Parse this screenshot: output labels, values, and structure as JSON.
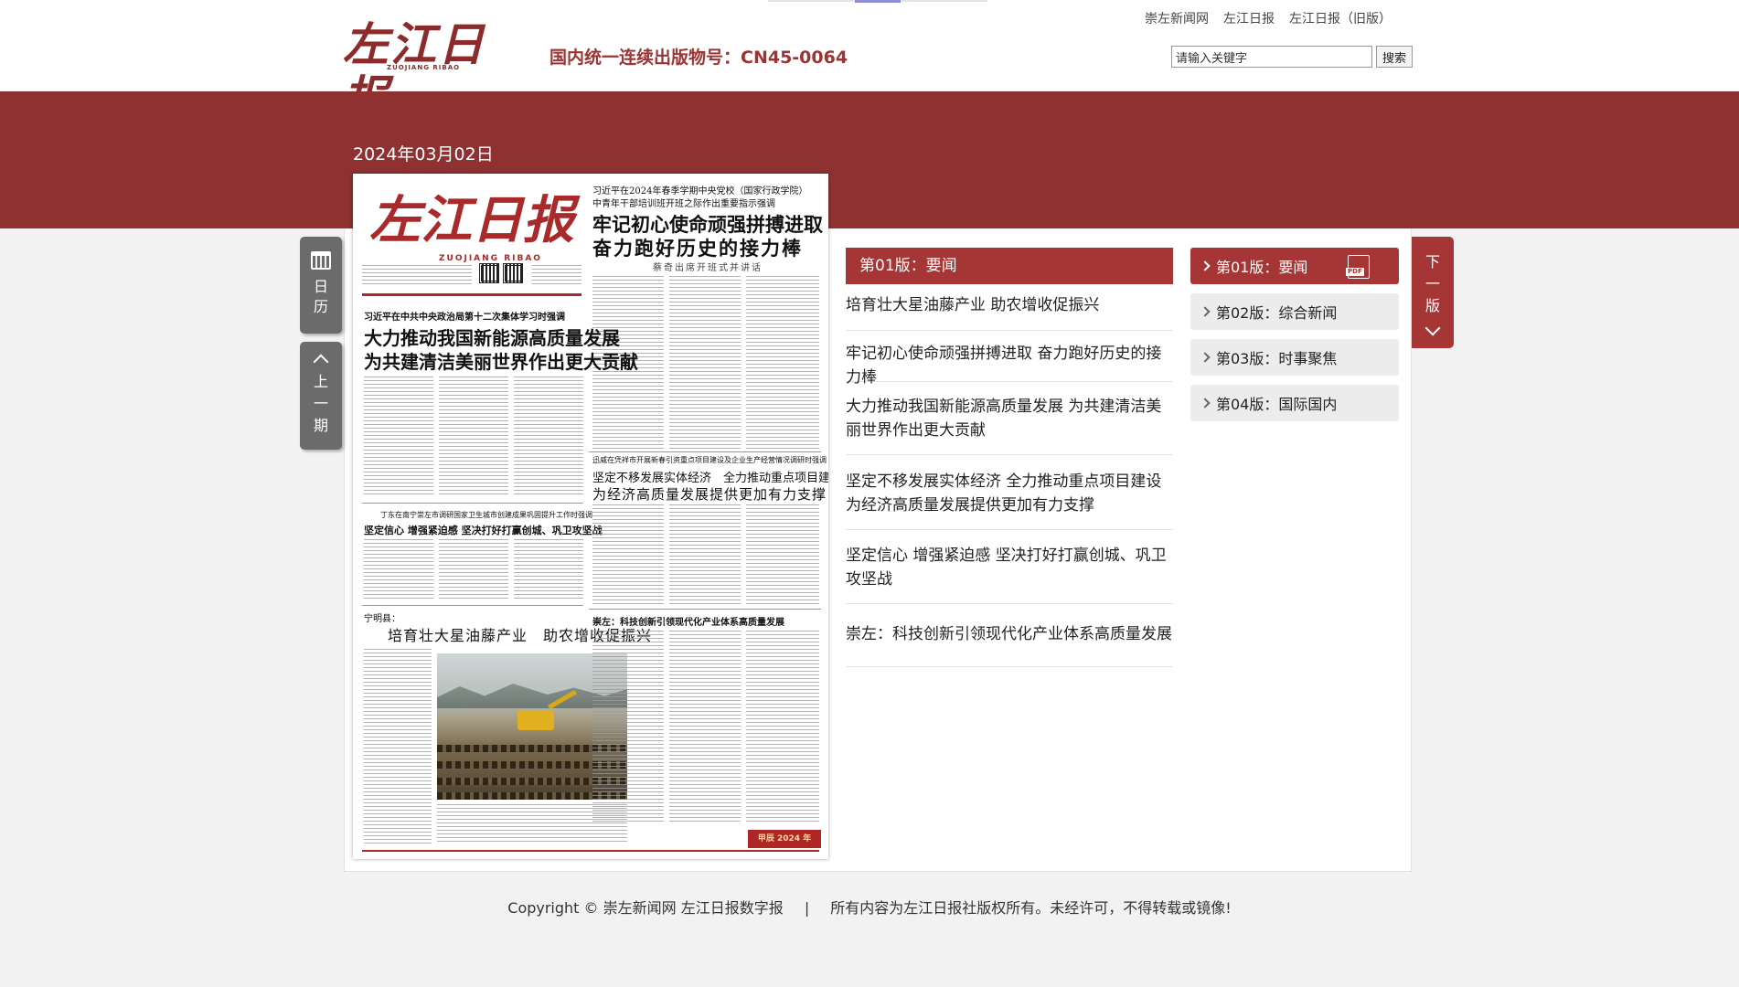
{
  "header": {
    "logo_text": "左江日报",
    "logo_sub": "ZUOJIANG RIBAO",
    "cn_number": "国内统一连续出版物号：CN45-0064",
    "links": [
      "崇左新闻网",
      "左江日报",
      "左江日报（旧版）"
    ],
    "search": {
      "placeholder": "请输入关键字",
      "button_label": "搜索"
    }
  },
  "date": "2024年03月02日",
  "newspaper": {
    "masthead": "左江日报",
    "masthead_sub": "ZUOJIANG RIBAO",
    "top_kicker_1": "习近平在2024年春季学期中央党校（国家行政学院）",
    "top_kicker_2": "中青年干部培训班开班之际作出重要指示强调",
    "top_head_1": "牢记初心使命顽强拼搏进取",
    "top_head_2": "奋力跑好历史的接力棒",
    "top_sub": "蔡奇出席开班式并讲话",
    "left_kicker": "习近平在中共中央政治局第十二次集体学习时强调",
    "left_head_1": "大力推动我国新能源高质量发展",
    "left_head_2": "为共建清洁美丽世界作出更大贡献",
    "mid_kicker": "迅威在凭祥市开展新春引资重点项目建设及企业生产经营情况调研时强调",
    "mid_head_1": "坚定不移发展实体经济　全力推动重点项目建设",
    "mid_head_2": "为经济高质量发展提供更加有力支撑",
    "small_kicker": "丁东在南宁崇左市调研国家卫生城市创建成果巩固提升工作时强调",
    "small_head": "坚定信心 增强紧迫感 坚决打好打赢创城、巩卫攻坚战",
    "bottom_kicker": "宁明县：",
    "bottom_head": "培育壮大星油藤产业　助农增收促振兴",
    "right_head": "崇左：科技创新引领现代化产业体系高质量发展",
    "badge": "甲辰 2024 年"
  },
  "tabs": {
    "calendar_label": "日历",
    "prev_label": "上一期",
    "next_label": "下一版"
  },
  "articles": {
    "heading": "第01版：要闻",
    "items": [
      "培育壮大星油藤产业 助农增收促振兴",
      "牢记初心使命顽强拼搏进取 奋力跑好历史的接力棒",
      "大力推动我国新能源高质量发展 为共建清洁美丽世界作出更大贡献",
      "坚定不移发展实体经济 全力推动重点项目建设 为经济高质量发展提供更加有力支撑",
      "坚定信心 增强紧迫感 坚决打好打赢创城、巩卫攻坚战",
      "崇左：科技创新引领现代化产业体系高质量发展"
    ]
  },
  "pages": {
    "items": [
      {
        "label": "第01版：要闻",
        "active": true
      },
      {
        "label": "第02版：综合新闻",
        "active": false
      },
      {
        "label": "第03版：时事聚焦",
        "active": false
      },
      {
        "label": "第04版：国际国内",
        "active": false
      }
    ],
    "pdf_label": "PDF"
  },
  "footer": {
    "copyright": "Copyright © 崇左新闻网 左江日报数字报",
    "separator": "|",
    "notice": "所有内容为左江日报社版权所有。未经许可，不得转载或镜像!"
  },
  "colors": {
    "brand_red": "#8f3031",
    "accent_red": "#a63535",
    "tab_gray": "#6b6b6b"
  }
}
